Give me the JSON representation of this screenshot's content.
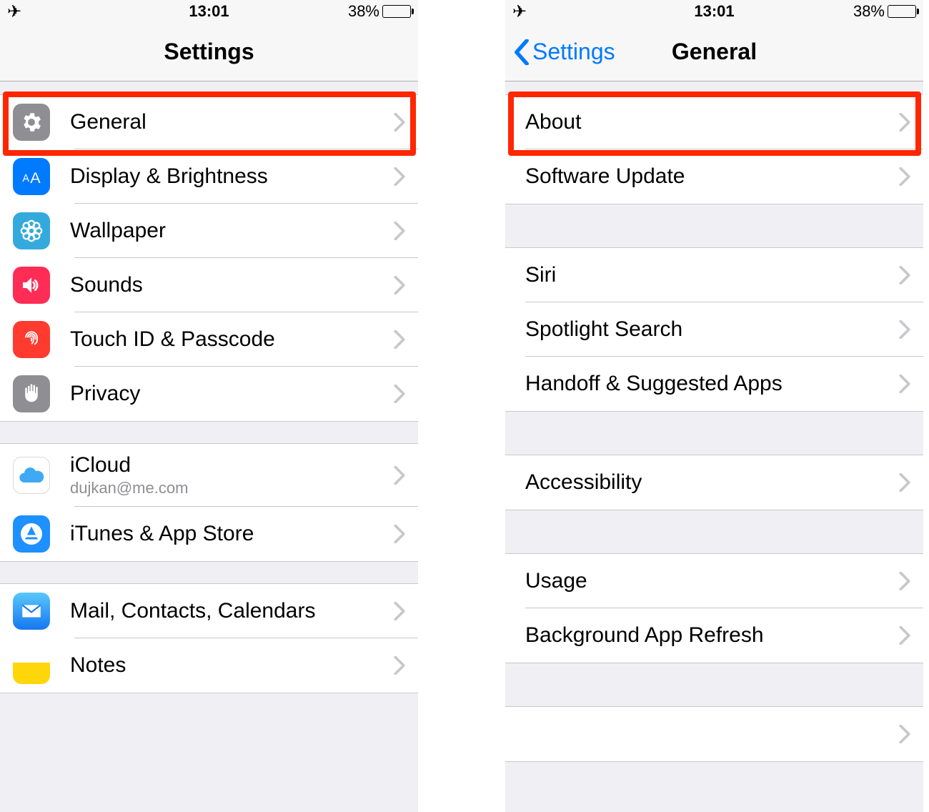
{
  "status": {
    "time": "13:01",
    "battery_pct": "38%"
  },
  "left": {
    "nav_title": "Settings",
    "groups": [
      [
        {
          "key": "general",
          "label": "General"
        },
        {
          "key": "display",
          "label": "Display & Brightness"
        },
        {
          "key": "wallpaper",
          "label": "Wallpaper"
        },
        {
          "key": "sounds",
          "label": "Sounds"
        },
        {
          "key": "touchid",
          "label": "Touch ID & Passcode"
        },
        {
          "key": "privacy",
          "label": "Privacy"
        }
      ],
      [
        {
          "key": "icloud",
          "label": "iCloud",
          "sublabel": "dujkan@me.com"
        },
        {
          "key": "appstore",
          "label": "iTunes & App Store"
        }
      ],
      [
        {
          "key": "mail",
          "label": "Mail, Contacts, Calendars"
        },
        {
          "key": "notes",
          "label": "Notes"
        }
      ]
    ]
  },
  "right": {
    "nav_back": "Settings",
    "nav_title": "General",
    "groups": [
      [
        {
          "key": "about",
          "label": "About"
        },
        {
          "key": "swupdate",
          "label": "Software Update"
        }
      ],
      [
        {
          "key": "siri",
          "label": "Siri"
        },
        {
          "key": "spotlight",
          "label": "Spotlight Search"
        },
        {
          "key": "handoff",
          "label": "Handoff & Suggested Apps"
        }
      ],
      [
        {
          "key": "accessibility",
          "label": "Accessibility"
        }
      ],
      [
        {
          "key": "usage",
          "label": "Usage"
        },
        {
          "key": "bgrefresh",
          "label": "Background App Refresh"
        }
      ],
      [
        {
          "key": "blank",
          "label": ""
        }
      ]
    ]
  }
}
